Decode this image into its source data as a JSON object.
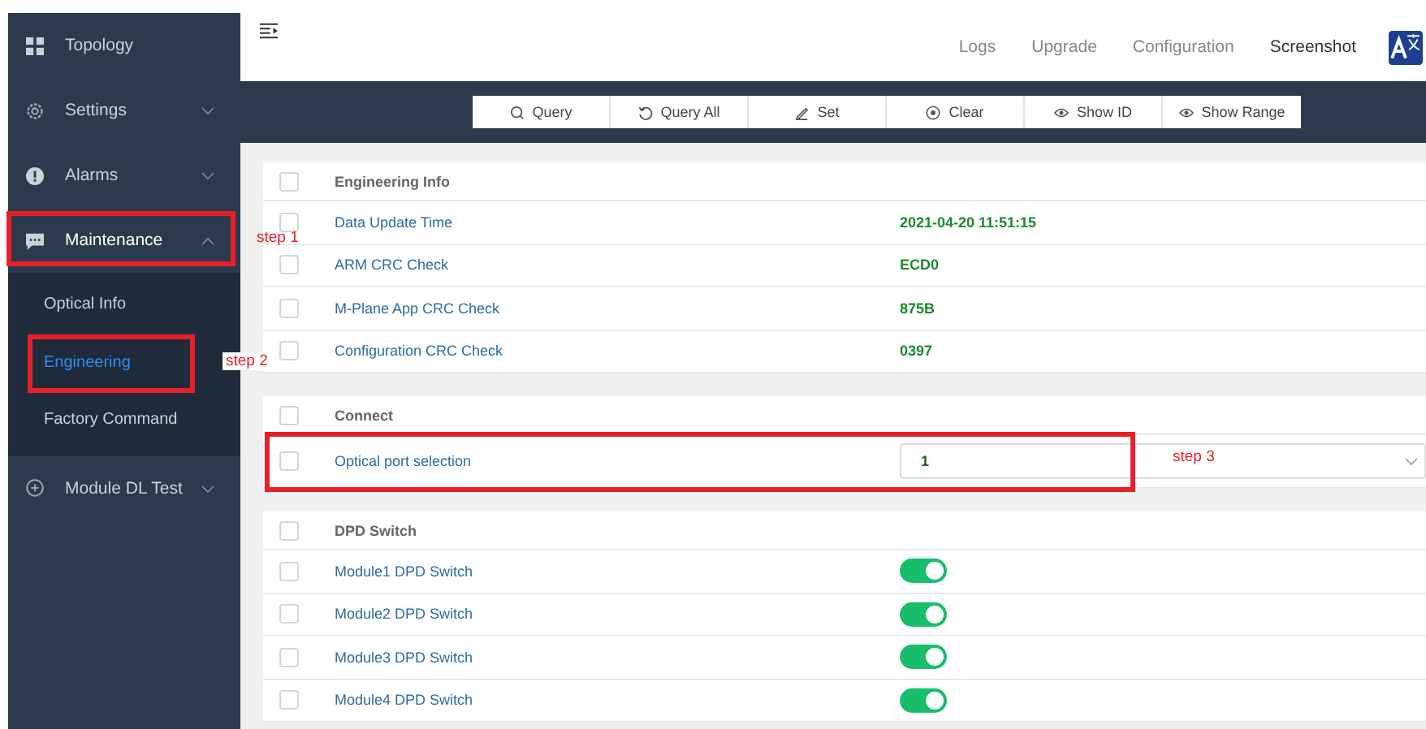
{
  "sidebar": {
    "items": [
      {
        "label": "Topology"
      },
      {
        "label": "Settings",
        "expanded": false
      },
      {
        "label": "Alarms",
        "expanded": false
      },
      {
        "label": "Maintenance",
        "expanded": true,
        "annotation": "step 1",
        "children": [
          {
            "label": "Optical Info",
            "selected": false
          },
          {
            "label": "Engineering",
            "selected": true,
            "annotation": "step 2"
          },
          {
            "label": "Factory Command",
            "selected": false
          }
        ]
      },
      {
        "label": "Module DL Test",
        "expanded": false
      }
    ]
  },
  "header": {
    "links": [
      {
        "label": "Logs",
        "selected": false
      },
      {
        "label": "Upgrade",
        "selected": false
      },
      {
        "label": "Configuration",
        "selected": false
      },
      {
        "label": "Screenshot",
        "selected": true
      }
    ]
  },
  "toolbar": [
    {
      "label": "Query"
    },
    {
      "label": "Query All"
    },
    {
      "label": "Set"
    },
    {
      "label": "Clear"
    },
    {
      "label": "Show ID"
    },
    {
      "label": "Show Range"
    }
  ],
  "sections": [
    {
      "title": "Engineering Info",
      "checked": false,
      "rows": [
        {
          "kind": "value",
          "label": "Data Update Time",
          "value": "2021-04-20 11:51:15",
          "checked": false
        },
        {
          "kind": "value",
          "label": "ARM CRC Check",
          "value": "ECD0",
          "checked": false
        },
        {
          "kind": "value",
          "label": "M-Plane App CRC Check",
          "value": "875B",
          "checked": false
        },
        {
          "kind": "value",
          "label": "Configuration CRC Check",
          "value": "0397",
          "checked": false
        }
      ]
    },
    {
      "title": "Connect",
      "checked": false,
      "rows": [
        {
          "kind": "select",
          "label": "Optical port selection",
          "value": "1",
          "checked": false,
          "annotation": "step 3"
        }
      ]
    },
    {
      "title": "DPD Switch",
      "checked": false,
      "rows": [
        {
          "kind": "switch",
          "label": "Module1 DPD Switch",
          "on": true,
          "checked": false
        },
        {
          "kind": "switch",
          "label": "Module2 DPD Switch",
          "on": true,
          "checked": false
        },
        {
          "kind": "switch",
          "label": "Module3 DPD Switch",
          "on": true,
          "checked": false
        },
        {
          "kind": "switch",
          "label": "Module4 DPD Switch",
          "on": true,
          "checked": false
        }
      ]
    }
  ]
}
